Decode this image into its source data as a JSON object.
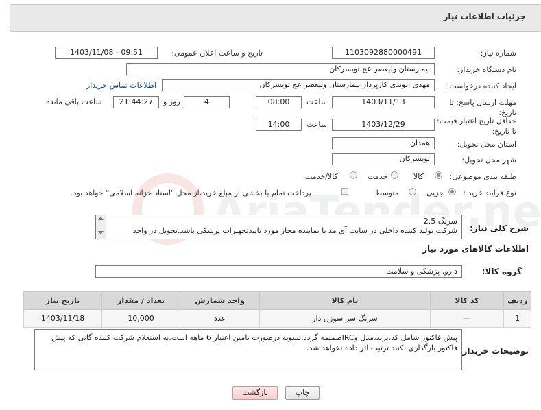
{
  "header": {
    "title": "جزئیات اطلاعات نیاز"
  },
  "fields": {
    "need_number_label": "شماره نیاز:",
    "need_number": "1103092880000491",
    "announce_label": "تاریخ و ساعت اعلان عمومی:",
    "announce_value": "1403/11/08 - 09:51",
    "buyer_label": "نام دستگاه خریدار:",
    "buyer_value": "بیمارستان ولیعصر  عج  تویسرکان",
    "creator_label": "ایجاد کننده درخواست:",
    "creator_value": "مهدی الوندی کارپرداز بیمارستان ولیعصر  عج  تویسرکان",
    "contact_link": "اطلاعات تماس خریدار",
    "deadline_label": "مهلت ارسال پاسخ: تا تاریخ:",
    "deadline_date": "1403/11/13",
    "time_label": "ساعت",
    "deadline_time": "08:00",
    "days_value": "4",
    "days_label": "روز و",
    "remaining_time": "21:44:27",
    "remaining_label": "ساعت باقی مانده",
    "validity_label": "حداقل تاریخ اعتبار قیمت: تا تاریخ:",
    "validity_date": "1403/12/29",
    "validity_time": "14:00",
    "province_label": "استان محل تحویل:",
    "province_value": "همدان",
    "city_label": "شهر محل تحویل:",
    "city_value": "تویسرکان",
    "category_label": "طبقه بندی موضوعی:",
    "category_options": [
      "کالا",
      "خدمت",
      "کالا/خدمت"
    ],
    "purchase_label": "نوع فرآیند خرید :",
    "purchase_options": [
      "جزیی",
      "متوسط"
    ],
    "payment_text": "پرداخت تمام یا بخشی از مبلغ خرید،از محل \"اسناد خزانه اسلامی\" خواهد بود."
  },
  "description": {
    "label": "شرح کلی نیاز:",
    "line1": "سرنگ 2.5",
    "line2": "شرکت تولید کننده داخلی در سایت آی مد با نماینده مجاز مورد تاییدتجهیزات پزشکی باشد.تحویل در واحد"
  },
  "goods_section": {
    "title": "اطلاعات کالاهای مورد نیاز",
    "group_label": "گروه کالا:",
    "group_value": "دارو، پزشکی و سلامت"
  },
  "table": {
    "headers": [
      "ردیف",
      "کد کالا",
      "نام کالا",
      "واحد شمارش",
      "تعداد / مقدار",
      "تاریخ نیاز"
    ],
    "rows": [
      [
        "1",
        "--",
        "سرنگ سر سوزن دار",
        "عدد",
        "10,000",
        "1403/11/18"
      ]
    ]
  },
  "buyer_notes": {
    "label": "توضیحات خریدار:",
    "text": "پیش فاکتور شامل کد،برند،مدل وIRCضمیمه گردد.تسویه درصورت تامین اعتبار 6 ماهه است.به استعلام شرکت کننده گانی که پیش فاکتور بارگذاری نکنند ترتیب اثر داده نخواهد شد."
  },
  "buttons": {
    "print": "چاپ",
    "back": "بازگشت"
  },
  "colors": {
    "accent_link": "#1a4d9c",
    "header_bg": "#e9e9e9",
    "table_header": "#d9d9d9"
  },
  "watermark": {
    "text": "AriaTender.neT"
  }
}
